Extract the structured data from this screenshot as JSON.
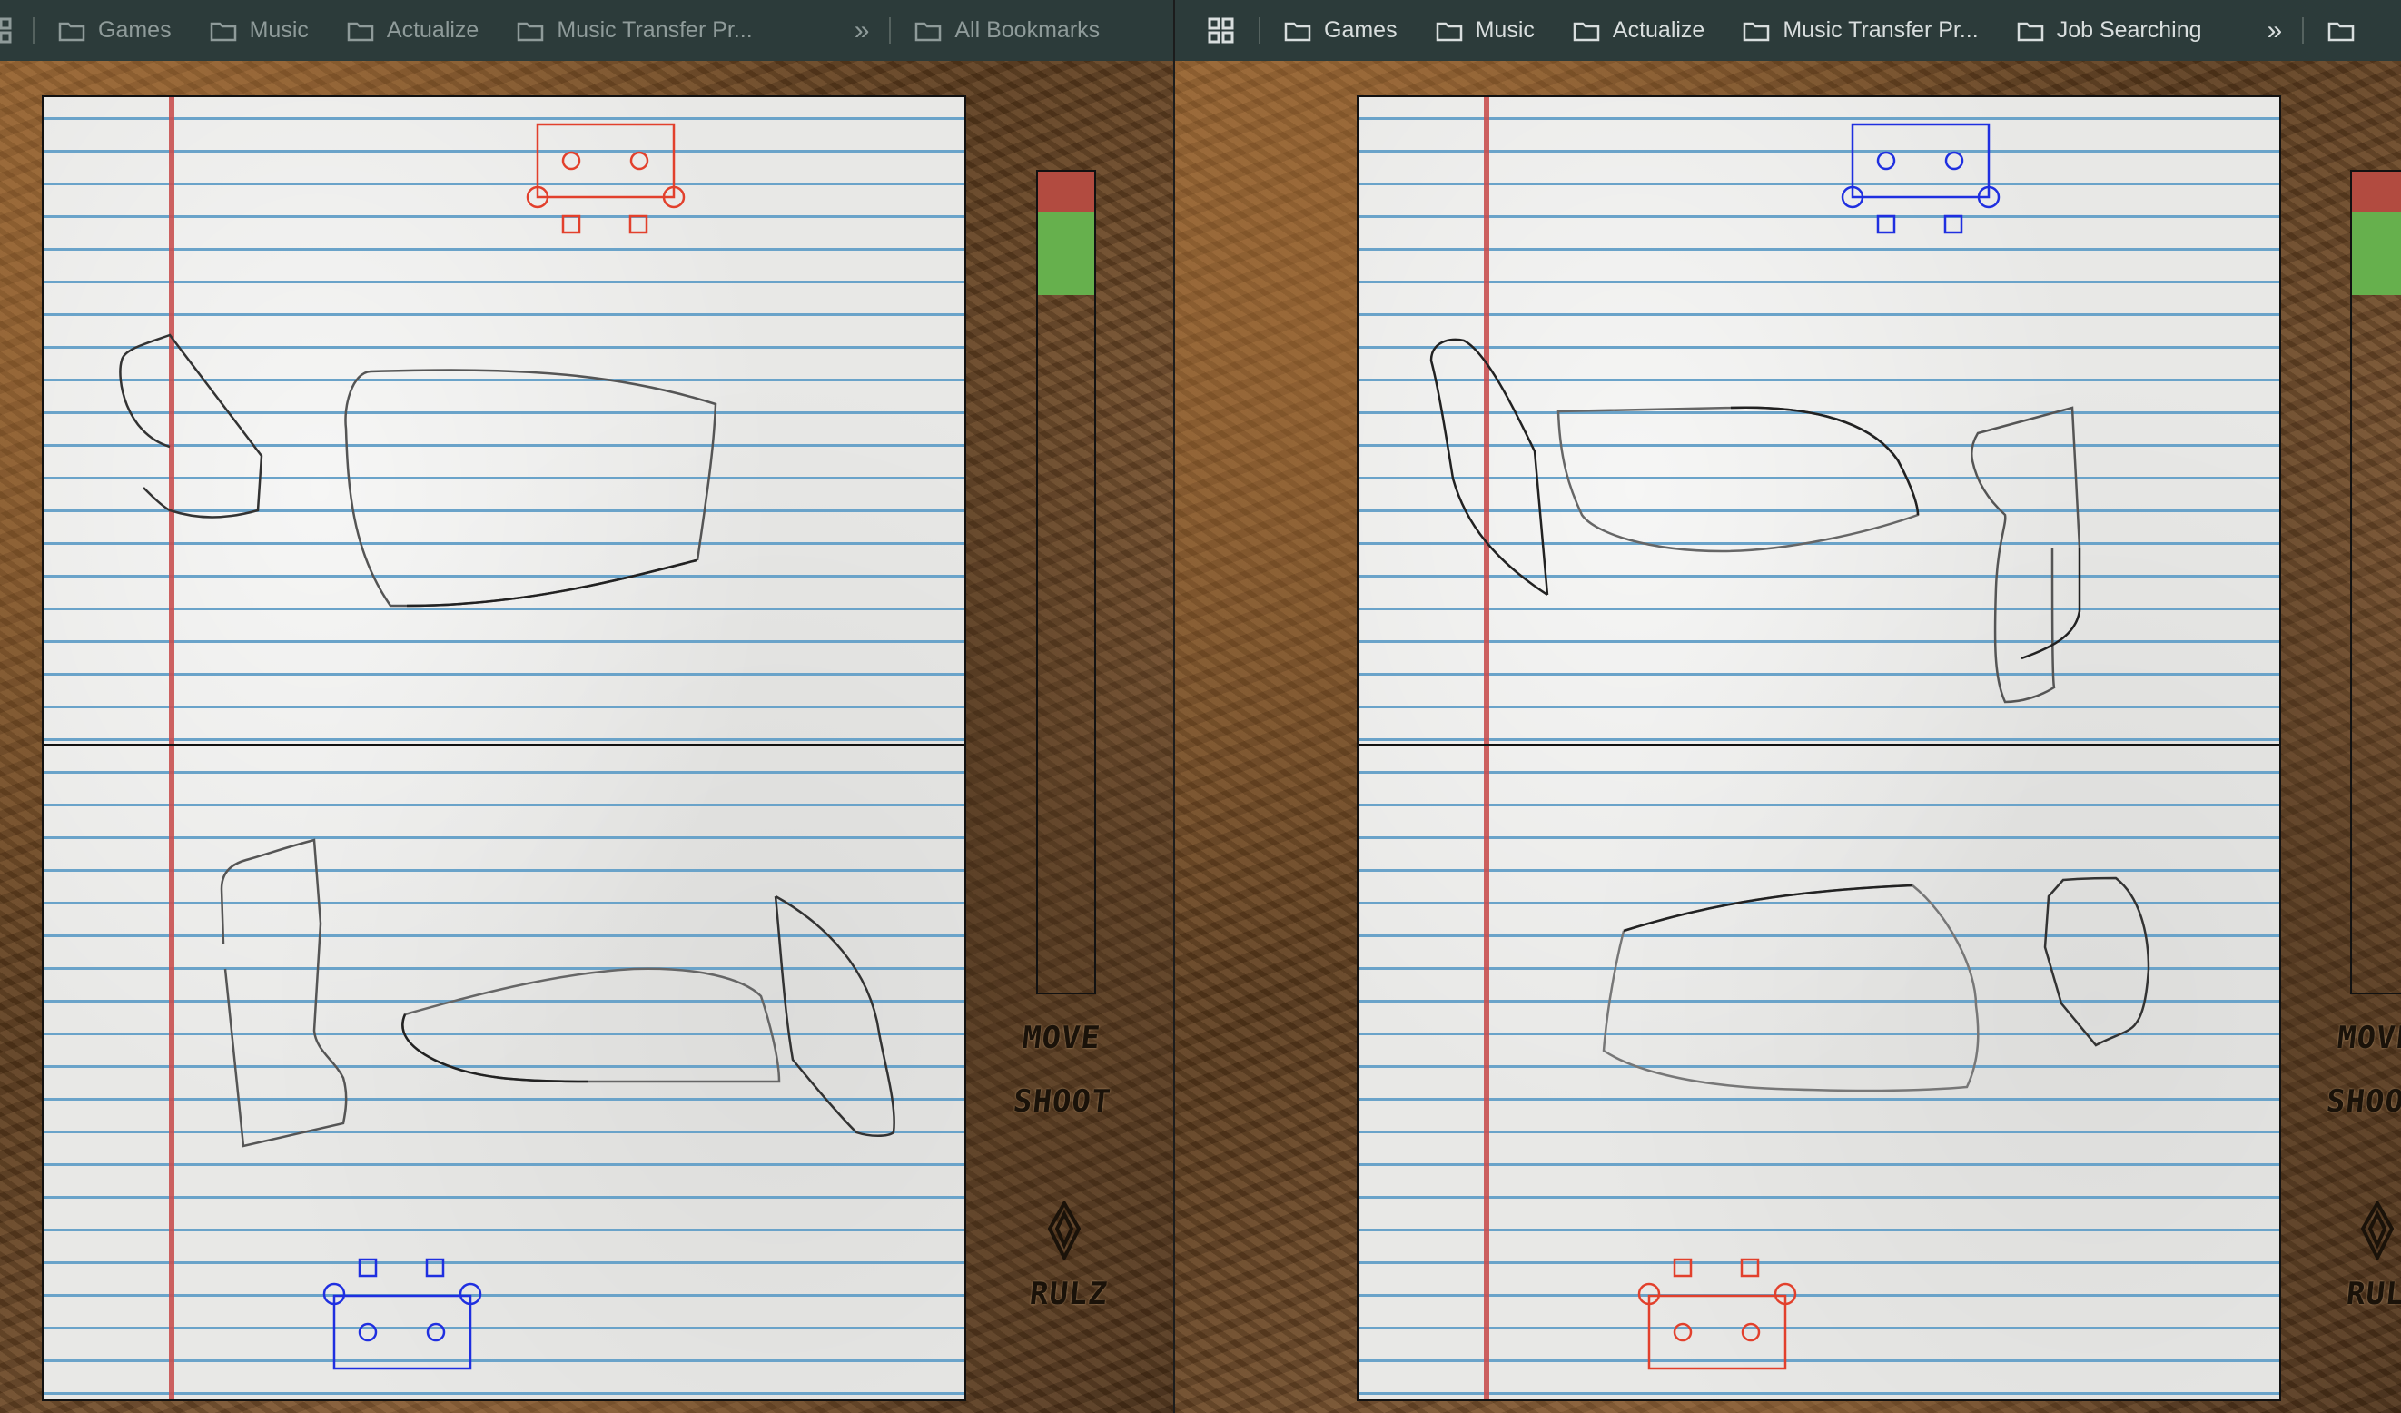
{
  "left_window": {
    "bookmarks": [
      {
        "label": "Games",
        "icon": "folder-icon"
      },
      {
        "label": "Music",
        "icon": "folder-icon"
      },
      {
        "label": "Actualize",
        "icon": "folder-icon"
      },
      {
        "label": "Music Transfer Pr...",
        "icon": "folder-icon"
      }
    ],
    "overflow": "»",
    "all_bookmarks": "All Bookmarks"
  },
  "right_window": {
    "bookmarks": [
      {
        "label": "Games",
        "icon": "folder-icon"
      },
      {
        "label": "Music",
        "icon": "folder-icon"
      },
      {
        "label": "Actualize",
        "icon": "folder-icon"
      },
      {
        "label": "Music Transfer Pr...",
        "icon": "folder-icon"
      },
      {
        "label": "Job Searching",
        "icon": "folder-icon"
      }
    ],
    "overflow": "»"
  },
  "game": {
    "controls": {
      "move": "MOVE",
      "shoot": "SHOOT",
      "rules": "RULZ",
      "rules_icon": "diamond-icon"
    },
    "colors": {
      "player_red": "#e2402c",
      "player_blue": "#1f2fe0",
      "health": "#66b04d",
      "damage": "#b24b40"
    }
  }
}
